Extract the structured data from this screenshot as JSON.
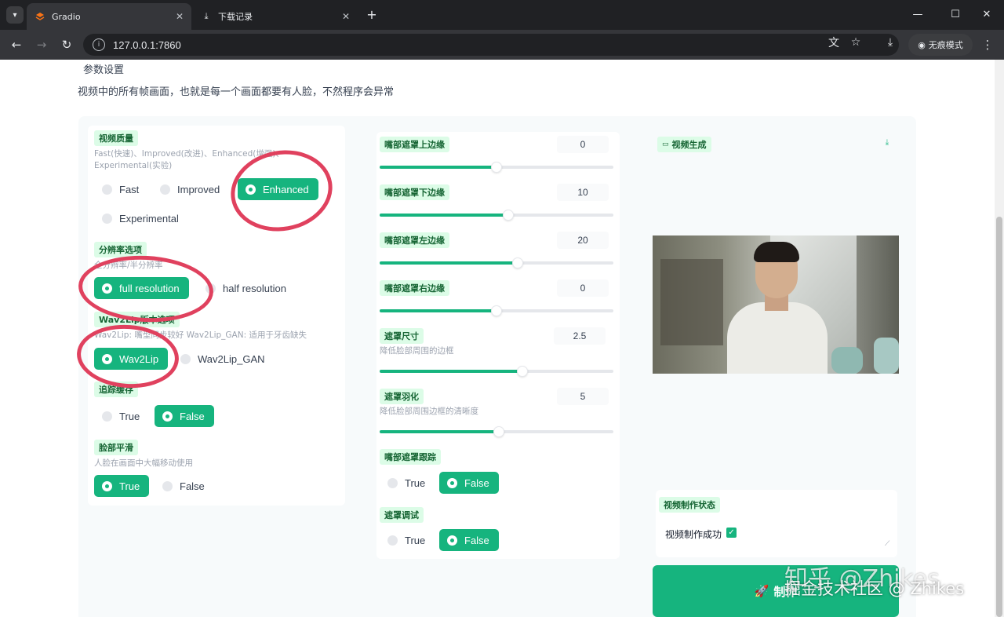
{
  "browser": {
    "tabs": [
      {
        "title": "Gradio",
        "icon": "gradio-logo-icon",
        "active": true
      },
      {
        "title": "下载记录",
        "icon": "download-icon",
        "active": false
      }
    ],
    "url": "127.0.0.1:7860",
    "incognito_label": "无痕模式"
  },
  "page": {
    "section_title": "参数设置",
    "notice": "视频中的所有帧画面，也就是每一个画面都要有人脸，不然程序会异常"
  },
  "left_column": {
    "video_quality": {
      "label": "视频质量",
      "description": "Fast(快速)、Improved(改进)、Enhanced(增强)、Experimental(实验)",
      "options": [
        "Fast",
        "Improved",
        "Enhanced",
        "Experimental"
      ],
      "selected": "Enhanced"
    },
    "resolution": {
      "label": "分辨率选项",
      "description": "全分辨率/半分辨率",
      "options": [
        "full resolution",
        "half resolution"
      ],
      "selected": "full resolution"
    },
    "wav2lip": {
      "label": "Wav2Lip版本选项",
      "description": "Wav2Lip: 嘴型同步较好 Wav2Lip_GAN: 适用于牙齿缺失",
      "options": [
        "Wav2Lip",
        "Wav2Lip_GAN"
      ],
      "selected": "Wav2Lip"
    },
    "tracking": {
      "label": "追踪缓存",
      "options": [
        "True",
        "False"
      ],
      "selected": "False"
    },
    "face_smooth": {
      "label": "脸部平滑",
      "description": "人脸在画面中大幅移动使用",
      "options": [
        "True",
        "False"
      ],
      "selected": "True"
    }
  },
  "middle_column": {
    "sliders": [
      {
        "label": "嘴部遮罩上边缘",
        "value": "0",
        "fill": 0.5
      },
      {
        "label": "嘴部遮罩下边缘",
        "value": "10",
        "fill": 0.55
      },
      {
        "label": "嘴部遮罩左边缘",
        "value": "20",
        "fill": 0.59
      },
      {
        "label": "嘴部遮罩右边缘",
        "value": "0",
        "fill": 0.5
      },
      {
        "label": "遮罩尺寸",
        "description": "降低脸部周围的边框",
        "value": "2.5",
        "fill": 0.61
      },
      {
        "label": "遮罩羽化",
        "description": "降低脸部周围边框的清晰度",
        "value": "5",
        "fill": 0.51
      }
    ],
    "mouth_tracking": {
      "label": "嘴部遮罩跟踪",
      "options": [
        "True",
        "False"
      ],
      "selected": "False"
    },
    "mask_debug": {
      "label": "遮罩调试",
      "options": [
        "True",
        "False"
      ],
      "selected": "False"
    }
  },
  "right_column": {
    "video_label": "视频生成",
    "status_label": "视频制作状态",
    "status_value": "视频制作成功",
    "make_button": "制作",
    "make_icon": "🚀"
  },
  "watermark": {
    "line1": "知乎 @Zhikes",
    "line2": "掘金技术社区 @ Zhikes"
  }
}
